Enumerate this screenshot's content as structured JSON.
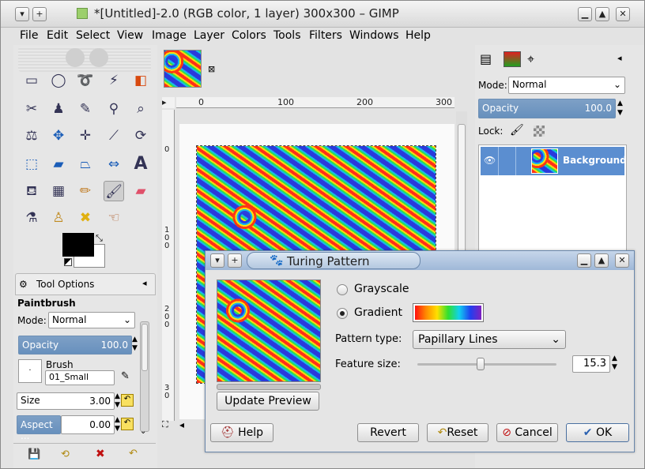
{
  "window": {
    "title": "*[Untitled]-2.0 (RGB color, 1 layer) 300x300 – GIMP"
  },
  "menu": [
    "File",
    "Edit",
    "Select",
    "View",
    "Image",
    "Layer",
    "Colors",
    "Tools",
    "Filters",
    "Windows",
    "Help"
  ],
  "tool_options": {
    "tab_label": "Tool Options",
    "tool_name": "Paintbrush",
    "mode_label": "Mode:",
    "mode_value": "Normal",
    "opacity_label": "Opacity",
    "opacity_value": "100.0",
    "brush_label": "Brush",
    "brush_value": "01_Small",
    "size_label": "Size",
    "size_value": "3.00",
    "aspect_label": "Aspect ...",
    "aspect_value": "0.00"
  },
  "ruler": {
    "h_ticks": [
      "0",
      "100",
      "200",
      "300"
    ],
    "v_ticks": [
      "0",
      "1\n0\n0",
      "2\n0\n0",
      "3\n0"
    ]
  },
  "layers": {
    "mode_label": "Mode:",
    "mode_value": "Normal",
    "opacity_label": "Opacity",
    "opacity_value": "100.0",
    "lock_label": "Lock:",
    "layer_name": "Background"
  },
  "dialog": {
    "title": "Turing Pattern",
    "grayscale_label": "Grayscale",
    "gradient_label": "Gradient",
    "pattern_type_label": "Pattern type:",
    "pattern_type_value": "Papillary Lines",
    "feature_size_label": "Feature size:",
    "feature_size_value": "15.3",
    "feature_size_fraction": 0.45,
    "update_preview": "Update Preview",
    "help": "Help",
    "revert": "Revert",
    "reset": "Reset",
    "cancel": "Cancel",
    "ok": "OK"
  }
}
